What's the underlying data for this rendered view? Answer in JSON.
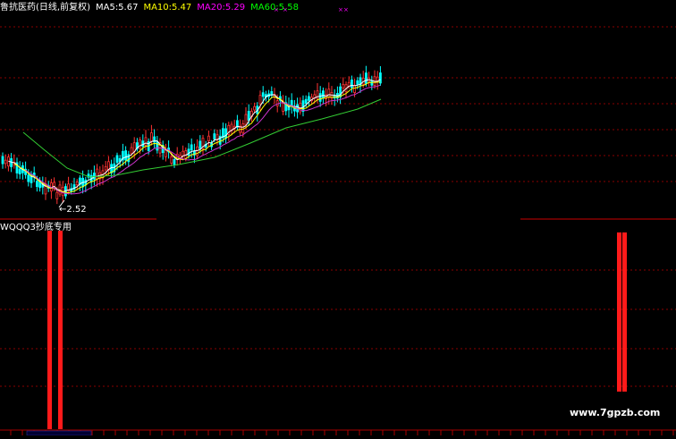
{
  "header": {
    "title": "鲁抗医药(日线,前复权)",
    "ma5": "MA5:5.67",
    "ma10": "MA10:5.47",
    "ma20": "MA20:5.29",
    "ma60": "MA60:5.58",
    "colors": {
      "title": "#ffffff",
      "ma5": "#ffffff",
      "ma10": "#ffff00",
      "ma20": "#ff00ff",
      "ma60": "#00ff00"
    }
  },
  "price_chart": {
    "low_label": "←2.52",
    "candles_up_color": "#ff3333",
    "candles_down_color": "#00ffff",
    "ma_colors": {
      "ma5": "#ffffff",
      "ma10": "#ffff00",
      "ma20": "#cc33cc",
      "ma60": "#33cc33"
    }
  },
  "indicator": {
    "title": "WQQQ3抄底专用",
    "bar_color": "#ff1a1a"
  },
  "watermark": "www.7gpzb.com"
}
